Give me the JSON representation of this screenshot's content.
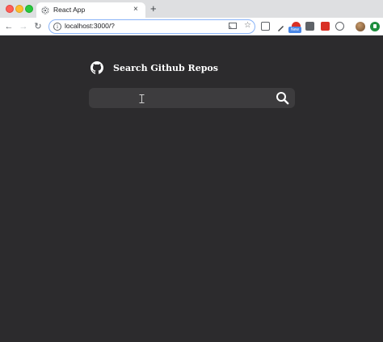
{
  "browser": {
    "tab_title": "React App",
    "tab_close": "×",
    "new_tab": "+",
    "url": "localhost:3000/?",
    "badge": "New"
  },
  "page": {
    "title": "Search Github Repos",
    "search": {
      "value": "",
      "placeholder": ""
    }
  },
  "icons": {
    "github": "github-icon",
    "search": "search-icon"
  },
  "colors": {
    "background": "#2c2b2d",
    "search_bar": "#3d3c3e",
    "text": "#ffffff",
    "omnibox_focus": "#89b4f8"
  }
}
